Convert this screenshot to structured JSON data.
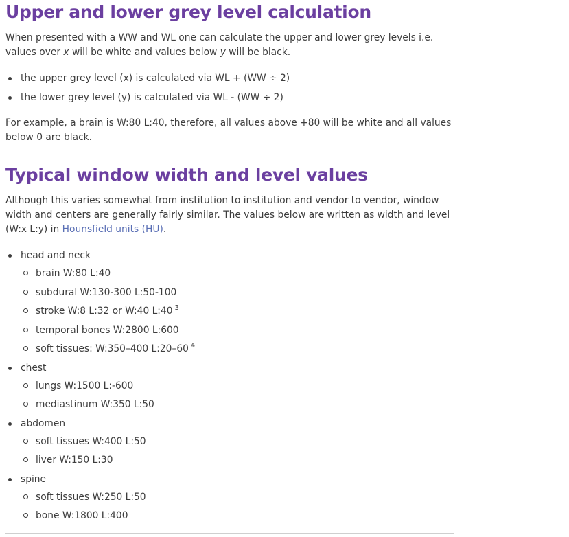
{
  "section1": {
    "heading": "Upper and lower grey level calculation",
    "intro_part1": "When presented with a WW and WL one can calculate the upper and lower grey levels i.e. values over ",
    "intro_x": "x",
    "intro_part2": " will be white and values below ",
    "intro_y": "y",
    "intro_part3": " will be black.",
    "bullets": [
      "the upper grey level (x) is calculated via WL + (WW ÷ 2)",
      "the lower grey level (y) is calculated via WL - (WW ÷ 2)"
    ],
    "example": "For example, a brain is W:80 L:40, therefore, all values above +80 will be white and all values below 0 are black."
  },
  "section2": {
    "heading": "Typical window width and level values",
    "intro_text": "Although this varies somewhat from institution to institution and vendor to vendor, window width and centers are generally fairly similar. The values below are written as width and level (W:x L:y) in ",
    "intro_link": "Hounsfield units (HU)",
    "intro_end": ".",
    "categories": [
      {
        "label": "head and neck",
        "items": [
          {
            "text": "brain W:80 L:40",
            "sup": ""
          },
          {
            "text": "subdural W:130-300 L:50-100",
            "sup": ""
          },
          {
            "text": "stroke W:8 L:32 or W:40 L:40",
            "sup": "3"
          },
          {
            "text": "temporal bones W:2800 L:600",
            "sup": ""
          },
          {
            "text": "soft tissues: W:350–400 L:20–60",
            "sup": "4"
          }
        ]
      },
      {
        "label": "chest",
        "items": [
          {
            "text": "lungs W:1500 L:-600",
            "sup": ""
          },
          {
            "text": "mediastinum W:350 L:50",
            "sup": ""
          }
        ]
      },
      {
        "label": "abdomen",
        "items": [
          {
            "text": "soft tissues W:400 L:50",
            "sup": ""
          },
          {
            "text": "liver W:150 L:30",
            "sup": ""
          }
        ]
      },
      {
        "label": "spine",
        "items": [
          {
            "text": "soft tissues W:250 L:50",
            "sup": ""
          },
          {
            "text": "bone W:1800 L:400",
            "sup": ""
          }
        ]
      }
    ]
  }
}
